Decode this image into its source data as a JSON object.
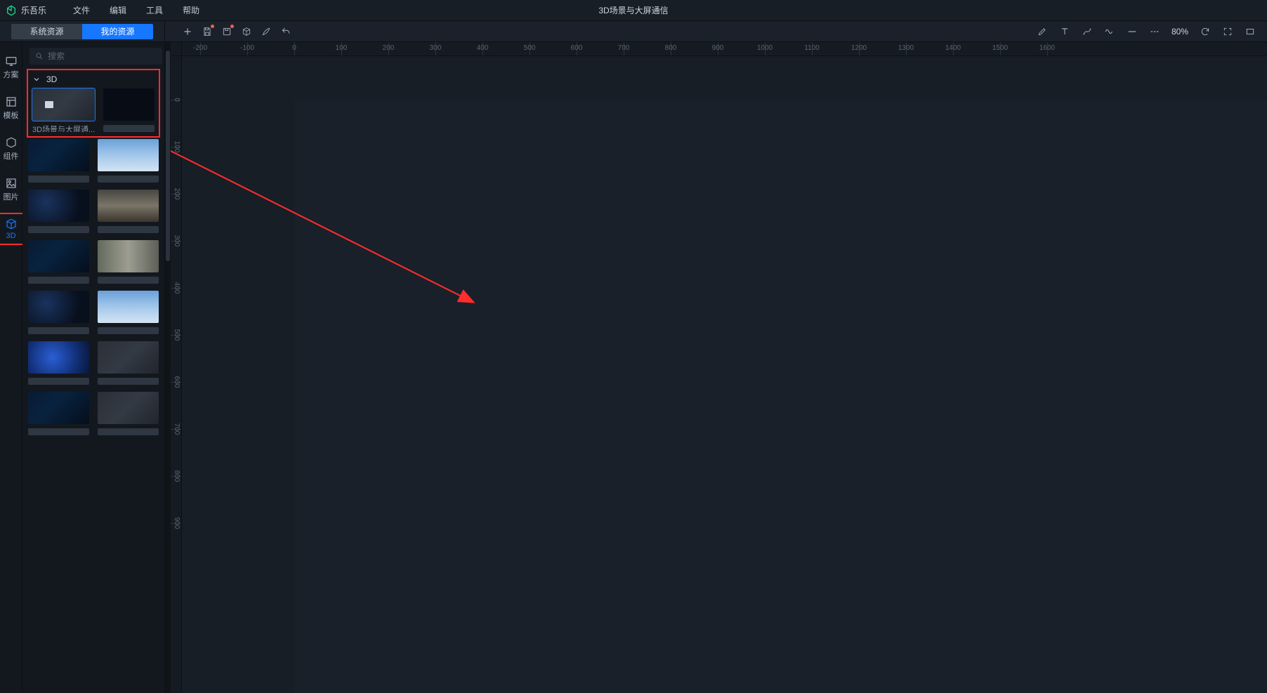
{
  "app": {
    "name": "乐吾乐"
  },
  "menubar": {
    "items": [
      "文件",
      "编辑",
      "工具",
      "帮助"
    ]
  },
  "document": {
    "title": "3D场景与大屏通信"
  },
  "resource_tabs": {
    "system": "系统资源",
    "mine": "我的资源",
    "active": "mine"
  },
  "toolbar": {
    "zoom_label": "80%"
  },
  "search": {
    "placeholder": "搜索"
  },
  "sidenav": {
    "items": [
      {
        "key": "scheme",
        "label": "方案"
      },
      {
        "key": "template",
        "label": "模板"
      },
      {
        "key": "component",
        "label": "组件"
      },
      {
        "key": "image",
        "label": "图片"
      },
      {
        "key": "threeD",
        "label": "3D"
      }
    ],
    "active": "threeD"
  },
  "asset_group": {
    "name": "3D"
  },
  "assets": {
    "featured": {
      "label": "3D场景与大屏通..."
    }
  },
  "ruler": {
    "h_ticks": [
      -200,
      -100,
      0,
      100,
      200,
      300,
      400,
      500,
      600,
      700,
      800,
      900,
      1000,
      1100,
      1200,
      1300,
      1400,
      1500,
      1600
    ],
    "v_ticks": [
      0,
      100,
      200,
      300,
      400,
      500,
      600,
      700,
      800,
      900
    ]
  },
  "colors": {
    "accent": "#1677ff",
    "annotation": "#ff2d2d"
  }
}
